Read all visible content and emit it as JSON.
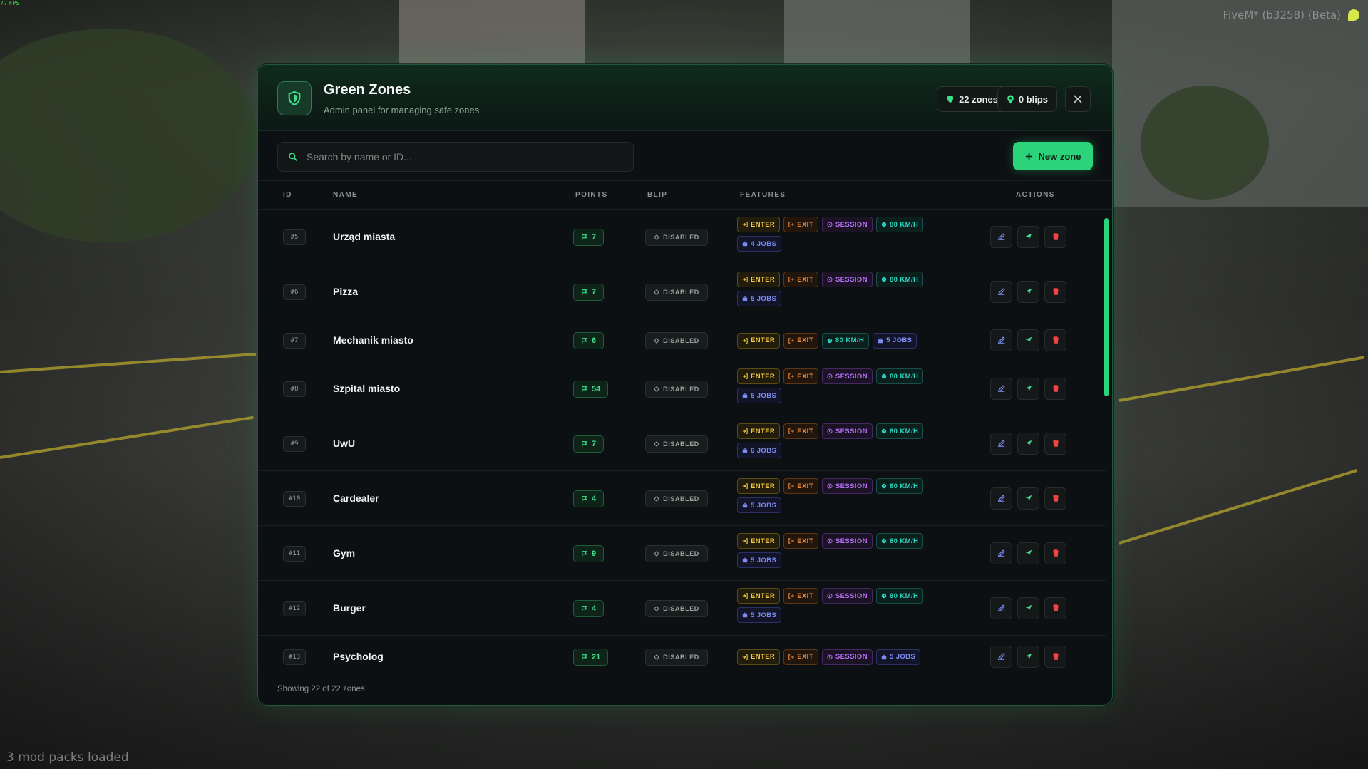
{
  "overlay": {
    "fps": "77 FPS",
    "client": "FiveM* (b3258) (Beta)",
    "mods": "3 mod packs loaded"
  },
  "header": {
    "title": "Green Zones",
    "subtitle": "Admin panel for managing safe zones",
    "zones_chip": "22 zones",
    "blips_chip": "0 blips"
  },
  "search": {
    "placeholder": "Search by name or ID..."
  },
  "toolbar": {
    "new_label": "New zone"
  },
  "columns": {
    "id": "ID",
    "name": "NAME",
    "points": "POINTS",
    "blip": "BLIP",
    "features": "FEATURES",
    "actions": "ACTIONS"
  },
  "rows": [
    {
      "id": "#5",
      "name": "Urząd miasta",
      "points": "7",
      "blip": "DISABLED",
      "features": [
        {
          "type": "enter",
          "label": "ENTER"
        },
        {
          "type": "exit",
          "label": "EXIT"
        },
        {
          "type": "session",
          "label": "SESSION"
        },
        {
          "type": "speed",
          "label": "80 KM/H"
        },
        {
          "type": "jobs",
          "label": "4 JOBS"
        }
      ]
    },
    {
      "id": "#6",
      "name": "Pizza",
      "points": "7",
      "blip": "DISABLED",
      "features": [
        {
          "type": "enter",
          "label": "ENTER"
        },
        {
          "type": "exit",
          "label": "EXIT"
        },
        {
          "type": "session",
          "label": "SESSION"
        },
        {
          "type": "speed",
          "label": "80 KM/H"
        },
        {
          "type": "jobs",
          "label": "5 JOBS"
        }
      ]
    },
    {
      "id": "#7",
      "name": "Mechanik miasto",
      "points": "6",
      "blip": "DISABLED",
      "features": [
        {
          "type": "enter",
          "label": "ENTER"
        },
        {
          "type": "exit",
          "label": "EXIT"
        },
        {
          "type": "speed",
          "label": "80 KM/H"
        },
        {
          "type": "jobs",
          "label": "5 JOBS"
        }
      ]
    },
    {
      "id": "#8",
      "name": "Szpital miasto",
      "points": "54",
      "blip": "DISABLED",
      "features": [
        {
          "type": "enter",
          "label": "ENTER"
        },
        {
          "type": "exit",
          "label": "EXIT"
        },
        {
          "type": "session",
          "label": "SESSION"
        },
        {
          "type": "speed",
          "label": "80 KM/H"
        },
        {
          "type": "jobs",
          "label": "5 JOBS"
        }
      ]
    },
    {
      "id": "#9",
      "name": "UwU",
      "points": "7",
      "blip": "DISABLED",
      "features": [
        {
          "type": "enter",
          "label": "ENTER"
        },
        {
          "type": "exit",
          "label": "EXIT"
        },
        {
          "type": "session",
          "label": "SESSION"
        },
        {
          "type": "speed",
          "label": "80 KM/H"
        },
        {
          "type": "jobs",
          "label": "6 JOBS"
        }
      ]
    },
    {
      "id": "#10",
      "name": "Cardealer",
      "points": "4",
      "blip": "DISABLED",
      "features": [
        {
          "type": "enter",
          "label": "ENTER"
        },
        {
          "type": "exit",
          "label": "EXIT"
        },
        {
          "type": "session",
          "label": "SESSION"
        },
        {
          "type": "speed",
          "label": "80 KM/H"
        },
        {
          "type": "jobs",
          "label": "5 JOBS"
        }
      ]
    },
    {
      "id": "#11",
      "name": "Gym",
      "points": "9",
      "blip": "DISABLED",
      "features": [
        {
          "type": "enter",
          "label": "ENTER"
        },
        {
          "type": "exit",
          "label": "EXIT"
        },
        {
          "type": "session",
          "label": "SESSION"
        },
        {
          "type": "speed",
          "label": "80 KM/H"
        },
        {
          "type": "jobs",
          "label": "5 JOBS"
        }
      ]
    },
    {
      "id": "#12",
      "name": "Burger",
      "points": "4",
      "blip": "DISABLED",
      "features": [
        {
          "type": "enter",
          "label": "ENTER"
        },
        {
          "type": "exit",
          "label": "EXIT"
        },
        {
          "type": "session",
          "label": "SESSION"
        },
        {
          "type": "speed",
          "label": "80 KM/H"
        },
        {
          "type": "jobs",
          "label": "5 JOBS"
        }
      ]
    },
    {
      "id": "#13",
      "name": "Psycholog",
      "points": "21",
      "blip": "DISABLED",
      "features": [
        {
          "type": "enter",
          "label": "ENTER"
        },
        {
          "type": "exit",
          "label": "EXIT"
        },
        {
          "type": "session",
          "label": "SESSION"
        },
        {
          "type": "jobs",
          "label": "5 JOBS"
        }
      ]
    }
  ],
  "footer": {
    "summary": "Showing 22 of 22 zones"
  },
  "colors": {
    "accent": "#2bd37a",
    "enter": "#f2c744",
    "exit": "#f08a3c",
    "session": "#b26ef0",
    "speed": "#2fd4c0",
    "jobs": "#7c8cf0",
    "edit_icon": "#7c8cf0",
    "locate_icon": "#3ee08a",
    "delete_icon": "#ef4444"
  },
  "icons": {
    "logo": "shield-icon",
    "zones_chip": "shield-icon",
    "blips_chip": "map-pin-icon",
    "close": "close-icon",
    "search": "search-icon",
    "new": "plus-icon",
    "points": "flag-icon",
    "blip": "diamond-icon",
    "edit": "edit-icon",
    "locate": "navigation-icon",
    "delete": "trash-icon"
  }
}
